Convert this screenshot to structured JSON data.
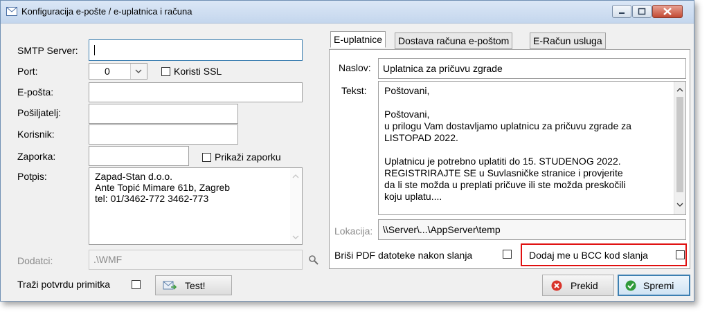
{
  "window": {
    "title": "Konfiguracija e-pošte / e-uplatnica i računa"
  },
  "form": {
    "smtp_label": "SMTP Server:",
    "smtp_value": "",
    "port_label": "Port:",
    "port_value": "0",
    "ssl_label": "Koristi SSL",
    "email_label": "E-pošta:",
    "email_value": "",
    "sender_label": "Pošiljatelj:",
    "sender_value": "",
    "user_label": "Korisnik:",
    "user_value": "",
    "password_label": "Zaporka:",
    "password_value": "",
    "show_password_label": "Prikaži zaporku",
    "signature_label": "Potpis:",
    "signature_lines": [
      "Zapad-Stan d.o.o.",
      "Ante Topić Mimare 61b, Zagreb",
      "tel: 01/3462-772 3462-773"
    ],
    "attachments_label": "Dodatci:",
    "attachments_value": ".\\WMF",
    "receipt_label": "Traži potvrdu primitka",
    "test_button": "Test!"
  },
  "tabs": [
    {
      "label": "E-uplatnice",
      "active": true
    },
    {
      "label": "Dostava računa e-poštom",
      "active": false
    },
    {
      "label": "E-Račun usluga",
      "active": false
    }
  ],
  "panel": {
    "subject_label": "Naslov:",
    "subject_value": "Uplatnica za pričuvu zgrade",
    "body_label": "Tekst:",
    "body_lines": [
      "Poštovani,",
      "",
      "Poštovani,",
      "u prilogu Vam dostavljamo uplatnicu za pričuvu zgrade za",
      "LISTOPAD 2022.",
      "",
      "Uplatnicu je potrebno uplatiti do 15. STUDENOG 2022.",
      "REGISTRIRAJTE SE u Suvlasničke stranice i provjerite",
      "da li ste možda u preplati pričuve ili ste možda preskočili",
      "koju uplatu...."
    ],
    "location_label": "Lokacija:",
    "location_value": "\\\\Server\\...\\AppServer\\temp",
    "delete_pdf_label": "Briši PDF datoteke nakon slanja",
    "bcc_label": "Dodaj me u BCC kod slanja"
  },
  "buttons": {
    "cancel": "Prekid",
    "save": "Spremi"
  },
  "colors": {
    "highlight": "#e01010",
    "save_border": "#3c7fb1"
  }
}
